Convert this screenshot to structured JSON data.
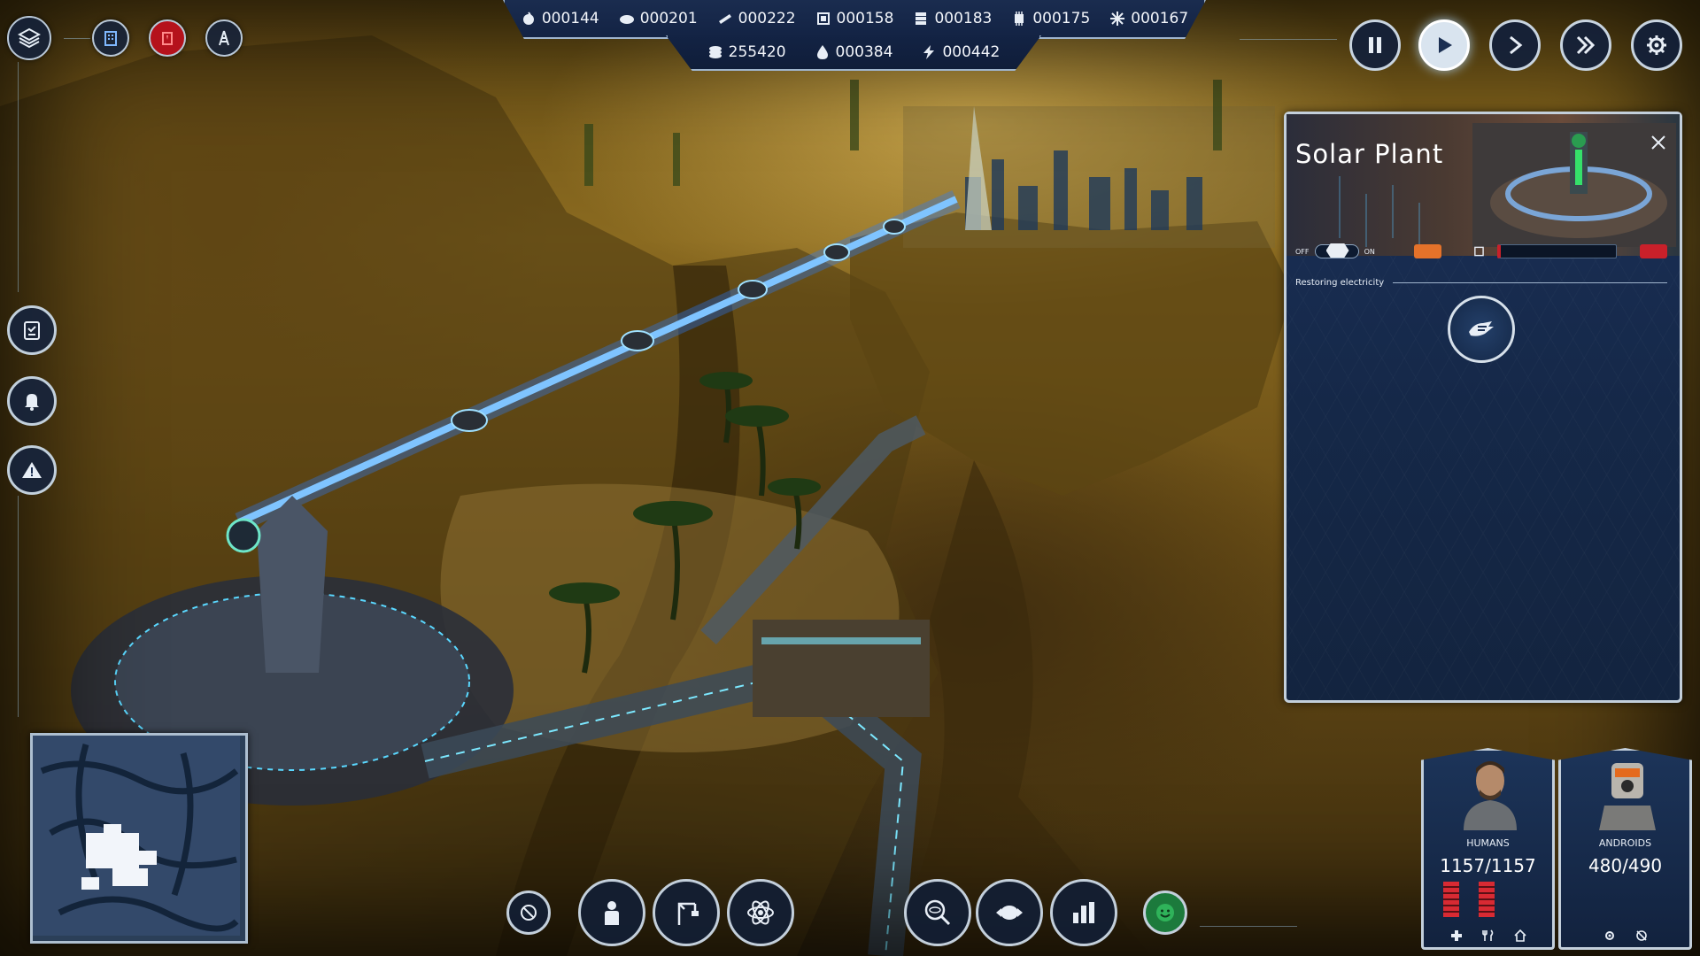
{
  "resources": {
    "top": [
      {
        "icon": "food-icon",
        "value": "000144"
      },
      {
        "icon": "stone-icon",
        "value": "000201"
      },
      {
        "icon": "planks-icon",
        "value": "000222"
      },
      {
        "icon": "chip-icon",
        "value": "000158"
      },
      {
        "icon": "steel-icon",
        "value": "000183"
      },
      {
        "icon": "processor-icon",
        "value": "000175"
      },
      {
        "icon": "snowflake-icon",
        "value": "000167"
      }
    ],
    "bottom": [
      {
        "icon": "coins-icon",
        "value": "255420"
      },
      {
        "icon": "water-drop-icon",
        "value": "000384"
      },
      {
        "icon": "lightning-icon",
        "value": "000442"
      }
    ]
  },
  "panel": {
    "title": "Solar Plant",
    "toggle_off": "OFF",
    "toggle_on": "ON",
    "section_title": "Restoring electricity"
  },
  "population": {
    "humans": {
      "label": "HUMANS",
      "count": "1157/1157"
    },
    "androids": {
      "label": "ANDROIDS",
      "count": "480/490"
    }
  },
  "colors": {
    "ui_navy": "#152848",
    "ui_border": "#c3cfdb",
    "beam_blue": "#4aa7ff",
    "alert_red": "#c9202a",
    "accent_orange": "#e5722a",
    "happy_green": "#2fb35a"
  }
}
